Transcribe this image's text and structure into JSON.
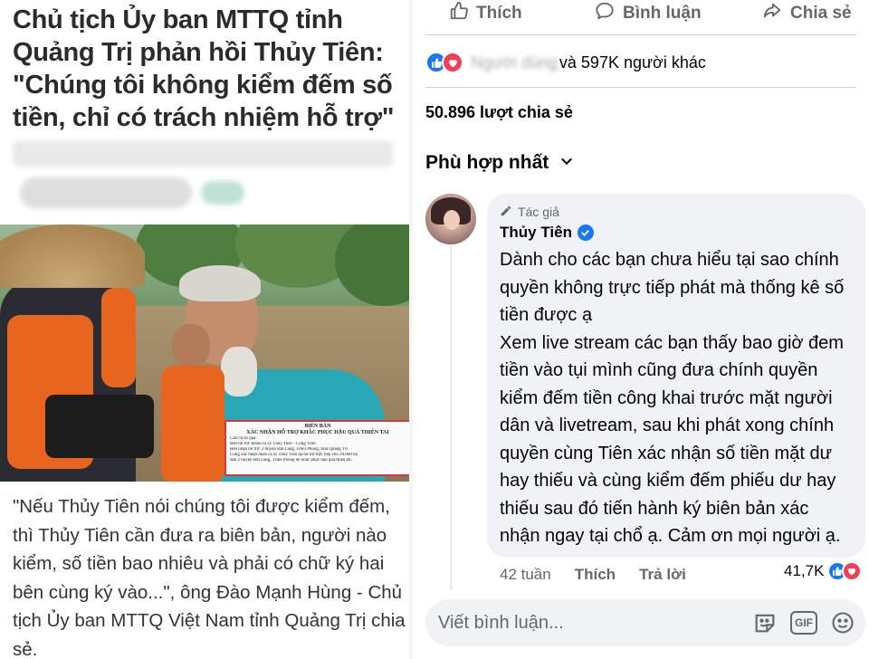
{
  "article": {
    "headline": "Chủ tịch Ủy ban MTTQ tỉnh Quảng Trị phản hồi Thủy Tiên: \"Chúng tôi không kiểm đếm số tiền, chỉ có trách nhiệm hỗ trợ\"",
    "blurred_source": "Thuy Tien",
    "document": {
      "title_1": "BIÊN BẢN",
      "title_2": "XÁC NHẬN HỖ TRỢ KHẮC PHỤC HẬU QUẢ THIÊN TAI",
      "lines": [
        "Căn cứ sổ quà:",
        "Bên hỗ trợ: Đoàn ca sỹ Thủy Tiên – Công Vinh",
        "Bên nhận hỗ trợ: 2 huyện Hải Lăng, Triệu Phong, tỉnh Quảng Trị",
        "Cùng xác nhận đoàn ca sỹ Thủy Tiên đã hỗ trợ trực tiếp cho 20.600 hộ",
        "dân 2 huyện Hải Lăng, Triệu Phong để khắc phục hậu quả thiên tai."
      ]
    },
    "quote": "\"Nếu Thủy Tiên nói chúng tôi được kiểm đếm, thì Thủy Tiên cần đưa ra biên bản, người nào kiểm, số tiền bao nhiêu và phải có chữ ký hai bên cùng ký vào...\", ông Đào Mạnh Hùng - Chủ tịch Ủy ban MTTQ Việt Nam tỉnh Quảng Trị chia sẻ."
  },
  "post": {
    "actions": {
      "like": "Thích",
      "comment": "Bình luận",
      "share": "Chia sẻ"
    },
    "reactions": {
      "blurred_names": "Người dùng",
      "text": "và 597K người khác"
    },
    "share_count": "50.896 lượt chia sẻ",
    "sort_label": "Phù hợp nhất"
  },
  "comment": {
    "author_tag": "Tác giả",
    "author": "Thủy Tiên",
    "text": "Dành cho các bạn chưa hiểu tại sao chính quyền không trực tiếp phát mà thống kê số tiền được ạ\nXem live stream các bạn thấy bao giờ đem tiền vào tụi mình cũng đưa chính quyền kiểm đếm tiền công khai trước mặt người dân và livetream, sau khi phát xong chính quyền cùng Tiên xác nhận số tiền mặt dư hay thiếu và cùng kiểm đếm phiếu dư hay thiếu sau đó tiến hành ký biên bản xác nhận ngay tại chổ ạ. Cảm ơn mọi người ạ.",
    "time": "42 tuần",
    "like_action": "Thích",
    "reply_action": "Trả lời",
    "reaction_count": "41,7K"
  },
  "composer": {
    "placeholder": "Viết bình luận..."
  },
  "icons": {
    "like": "thumbs-up-icon",
    "comment": "speech-bubble-icon",
    "share": "share-arrow-icon",
    "verified": "verified-badge-icon",
    "sticker": "sticker-icon",
    "gif": "gif-icon",
    "emoji": "emoji-icon"
  },
  "colors": {
    "facebook_blue": "#1877f2",
    "love_red": "#f33e58",
    "secondary_text": "#65676b",
    "bubble_bg": "#f0f2f5",
    "document_border": "#d23b3b"
  }
}
